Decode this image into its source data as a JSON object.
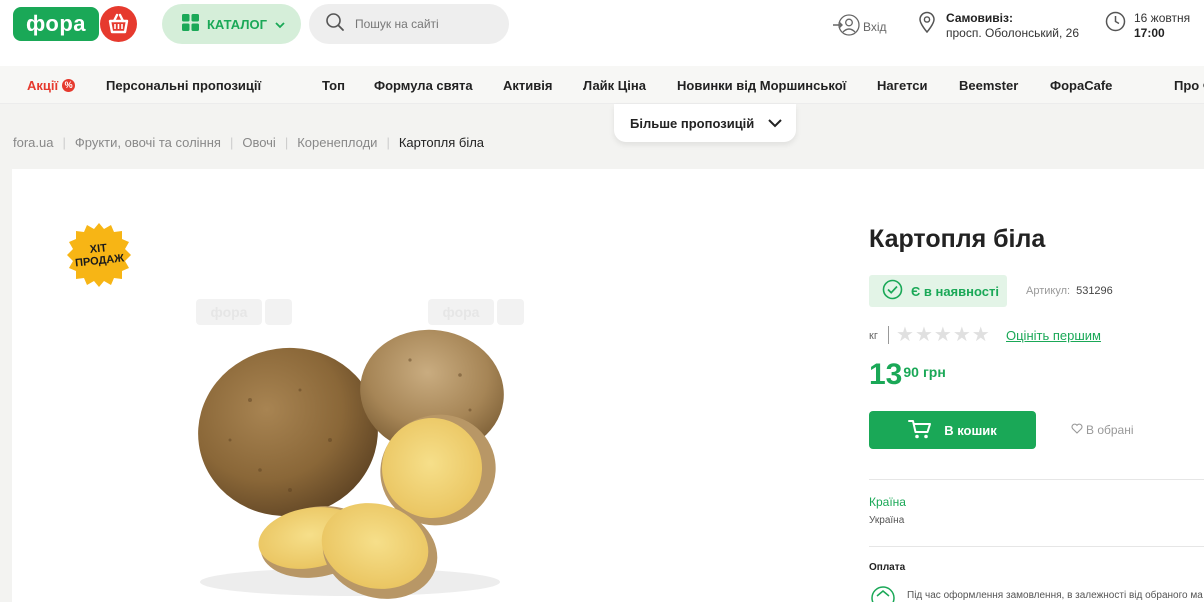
{
  "header": {
    "logo_text": "фора",
    "catalog_label": "КАТАЛОГ",
    "search_placeholder": "Пошук на сайті",
    "login_label": "Вхід",
    "pickup_title": "Самовивіз:",
    "pickup_address": "просп. Оболонський, 26",
    "delivery_date": "16 жовтня",
    "delivery_time": "17:00"
  },
  "nav": {
    "items": [
      {
        "label": "Акції"
      },
      {
        "label": "Персональні пропозиції"
      },
      {
        "label": "Топ"
      },
      {
        "label": "Формула свята"
      },
      {
        "label": "Активія"
      },
      {
        "label": "Лайк Ціна"
      },
      {
        "label": "Новинки від Моршинської"
      },
      {
        "label": "Нагетси"
      },
      {
        "label": "Beemster"
      },
      {
        "label": "ФораCafe"
      },
      {
        "label": "Про Ф"
      }
    ],
    "sale_badge": "%",
    "more_label": "Більше пропозицій"
  },
  "breadcrumbs": [
    "fora.ua",
    "Фрукти, овочі та соління",
    "Овочі",
    "Коренеплоди",
    "Картопля біла"
  ],
  "product": {
    "badge_line1": "ХІТ",
    "badge_line2": "ПРОДАЖ",
    "watermark": "фора",
    "title": "Картопля біла",
    "stock_label": "Є в наявності",
    "sku_label": "Артикул:",
    "sku_value": "531296",
    "unit": "кг",
    "rating_stars": 0,
    "rating_max": 5,
    "rate_link": "Оцініть першим",
    "price_int": "13",
    "price_dec": "90",
    "currency": "грн",
    "cart_label": "В кошик",
    "favorite_label": "В обрані",
    "country_label": "Країна",
    "country_value": "Україна",
    "payment_label": "Оплата",
    "payment_text": "Під час оформлення замовлення, в залежності від обраного ма"
  },
  "colors": {
    "brand_green": "#1aa857",
    "brand_red": "#e63a2e",
    "badge_yellow": "#f7b515"
  }
}
